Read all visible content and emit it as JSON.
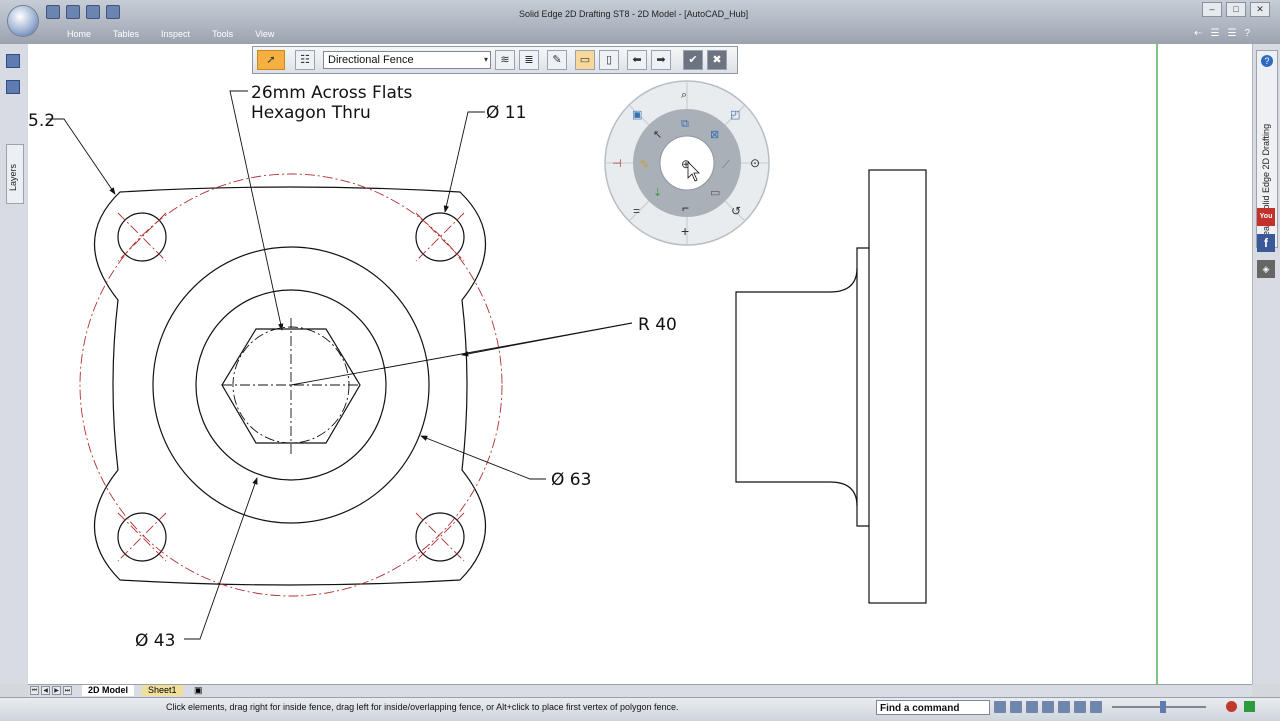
{
  "window": {
    "title": "Solid Edge 2D Drafting ST8 - 2D Model - [AutoCAD_Hub]"
  },
  "menu": [
    "Home",
    "Tables",
    "Inspect",
    "Tools",
    "View"
  ],
  "window_controls": {
    "minimize": "–",
    "restore": "□",
    "close": "✕"
  },
  "left_panel": {
    "layers_label": "Layers"
  },
  "right_panel": {
    "learn_label": "Learn Solid Edge 2D Drafting",
    "help": "?",
    "youtube": "You",
    "facebook": "f"
  },
  "toolbar": {
    "select_value": "Directional Fence",
    "caret": "▾"
  },
  "drawing": {
    "label_hex_line1": "26mm Across Flats",
    "label_hex_line2": "Hexagon Thru",
    "label_dia11": "Ø 11",
    "label_r40": "R 40",
    "label_dia63": "Ø 63",
    "label_dia43": "Ø 43",
    "label_cut": "5.2"
  },
  "sheets": {
    "tabs": [
      "2D Model",
      "Sheet1"
    ]
  },
  "status": {
    "message": "Click elements, drag right for inside fence, drag left for inside/overlapping fence, or Alt+click to place first vertex of polygon fence.",
    "find_command": "Find a command"
  },
  "colors": {
    "centerline": "#b03030",
    "accent_border": "#52b352",
    "select_tool": "#f5b041"
  },
  "icons": {
    "select": "select-arrow-icon",
    "zoom": "zoom-icon",
    "accept": "check-icon",
    "cancel": "close-icon"
  }
}
